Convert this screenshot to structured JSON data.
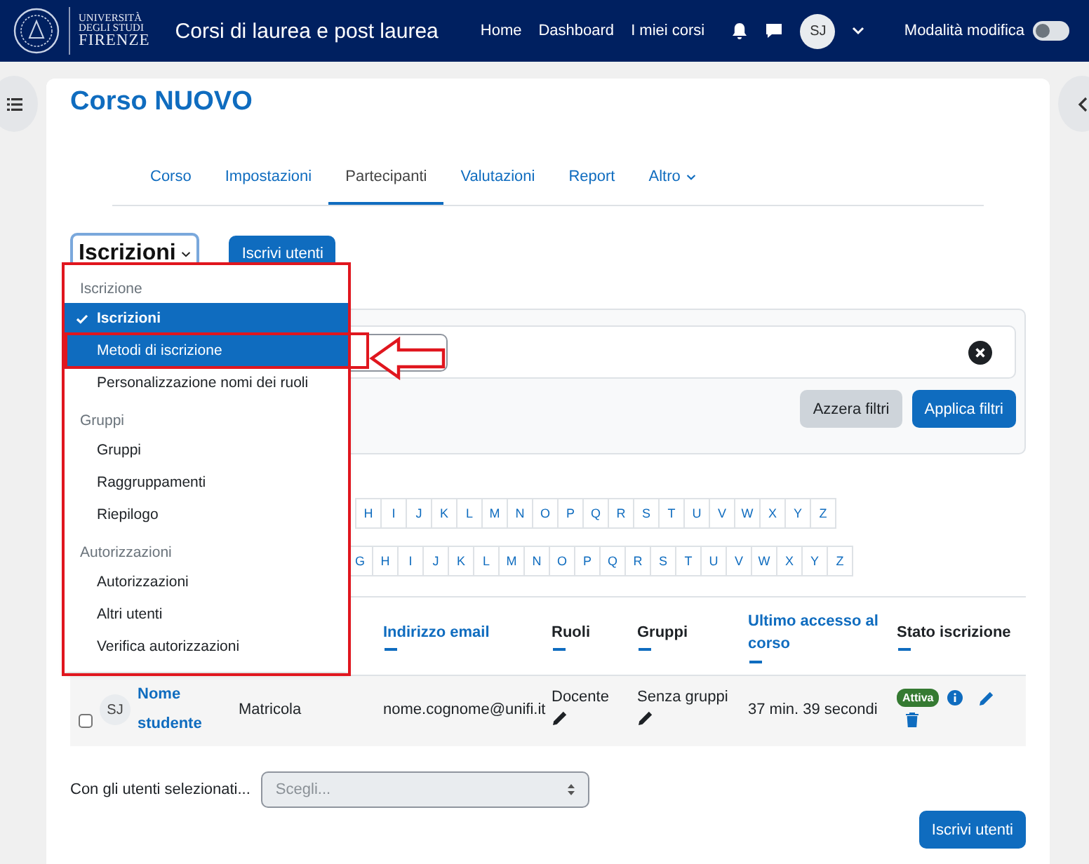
{
  "navbar": {
    "logo_lines": [
      "UNIVERSITÀ",
      "DEGLI STUDI",
      "FIRENZE"
    ],
    "site_name": "Corsi di laurea e post laurea",
    "links": [
      "Home",
      "Dashboard",
      "I miei corsi"
    ],
    "avatar": "SJ",
    "edit_mode": {
      "label": "Modalità modifica",
      "on": false
    }
  },
  "course_title": "Corso NUOVO",
  "tabs": [
    {
      "label": "Corso",
      "selected": false
    },
    {
      "label": "Impostazioni",
      "selected": false
    },
    {
      "label": "Partecipanti",
      "selected": true
    },
    {
      "label": "Valutazioni",
      "selected": false
    },
    {
      "label": "Report",
      "selected": false
    },
    {
      "label": "Altro",
      "selected": false,
      "has_menu": true
    }
  ],
  "page_select": {
    "value": "Iscrizioni"
  },
  "enrol_button": "Iscrivi utenti",
  "dropdown": [
    {
      "header": "Iscrizione",
      "items": [
        {
          "label": "Iscrizioni",
          "selected": true,
          "focused": false
        },
        {
          "label": "Metodi di iscrizione",
          "selected": false,
          "focused": true
        },
        {
          "label": "Personalizzazione nomi dei ruoli",
          "selected": false,
          "focused": false
        }
      ]
    },
    {
      "header": "Gruppi",
      "items": [
        {
          "label": "Gruppi",
          "selected": false,
          "focused": false
        },
        {
          "label": "Raggruppamenti",
          "selected": false,
          "focused": false
        },
        {
          "label": "Riepilogo",
          "selected": false,
          "focused": false
        }
      ]
    },
    {
      "header": "Autorizzazioni",
      "items": [
        {
          "label": "Autorizzazioni",
          "selected": false,
          "focused": false
        },
        {
          "label": "Altri utenti",
          "selected": false,
          "focused": false
        },
        {
          "label": "Verifica autorizzazioni",
          "selected": false,
          "focused": false
        }
      ]
    }
  ],
  "filters": {
    "buttons": [
      {
        "label": "Azzera filtri",
        "kind": "secondary"
      },
      {
        "label": "Applica filtri",
        "kind": "primary"
      }
    ]
  },
  "initials_rows": [
    [
      "H",
      "I",
      "J",
      "K",
      "L",
      "M",
      "N",
      "O",
      "P",
      "Q",
      "R",
      "S",
      "T",
      "U",
      "V",
      "W",
      "X",
      "Y",
      "Z"
    ],
    [
      "G",
      "H",
      "I",
      "J",
      "K",
      "L",
      "M",
      "N",
      "O",
      "P",
      "Q",
      "R",
      "S",
      "T",
      "U",
      "V",
      "W",
      "X",
      "Y",
      "Z"
    ]
  ],
  "table": {
    "columns": [
      {
        "label": "Indirizzo email",
        "sortable": true
      },
      {
        "label": "Ruoli",
        "sortable": false
      },
      {
        "label": "Gruppi",
        "sortable": false
      },
      {
        "label": "Ultimo accesso al corso",
        "sortable": true
      },
      {
        "label": "Stato iscrizione",
        "sortable": false
      }
    ],
    "rows": [
      {
        "checked": false,
        "avatar": "SJ",
        "name": "Nome studente",
        "id_number": "Matricola",
        "email": "nome.cognome@unifi.it",
        "role": "Docente",
        "groups": "Senza gruppi",
        "last_access": "37 min. 39 secondi",
        "status": "Attiva"
      }
    ]
  },
  "bulk": {
    "label": "Con gli utenti selezionati...",
    "placeholder": "Scegli..."
  },
  "footer_button": "Iscrivi utenti"
}
